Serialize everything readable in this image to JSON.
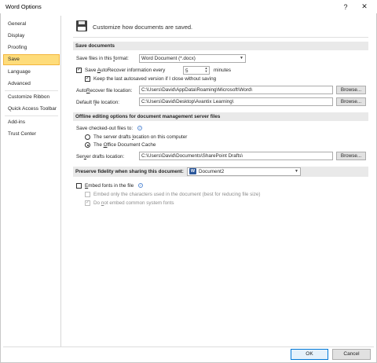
{
  "window": {
    "title": "Word Options",
    "help_glyph": "?",
    "close_glyph": "✕"
  },
  "sidebar": {
    "items": [
      {
        "label": "General"
      },
      {
        "label": "Display"
      },
      {
        "label": "Proofing"
      },
      {
        "label": "Save",
        "selected": true
      },
      {
        "label": "Language"
      },
      {
        "label": "Advanced"
      },
      {
        "label": "Customize Ribbon"
      },
      {
        "label": "Quick Access Toolbar"
      },
      {
        "label": "Add-ins"
      },
      {
        "label": "Trust Center"
      }
    ]
  },
  "header": {
    "icon": "save-icon",
    "text": "Customize how documents are saved."
  },
  "save_documents": {
    "title": "Save documents",
    "format_label_pre": "Save files in this ",
    "format_label_u": "f",
    "format_label_post": "ormat:",
    "format_value": "Word Document (*.docx)",
    "autorecover_pre": "Save ",
    "autorecover_u": "A",
    "autorecover_post": "utoRecover information every",
    "autorecover_checked": "✓",
    "autorecover_minutes": "5",
    "minutes_label": "minutes",
    "keep_last_label": "Keep the last autosaved version if I close without saving",
    "keep_last_checked": "✓",
    "autorecover_location_pre": "Auto",
    "autorecover_location_u": "R",
    "autorecover_location_post": "ecover file location:",
    "autorecover_location_value": "C:\\Users\\David\\AppData\\Roaming\\Microsoft\\Word\\",
    "default_location_pre": "Default f",
    "default_location_u": "i",
    "default_location_post": "le location:",
    "default_location_value": "C:\\Users\\David\\Desktop\\Avantix Learning\\",
    "browse_label": "Browse..."
  },
  "offline_editing": {
    "title": "Offline editing options for document management server files",
    "save_checked_out_label": "Save checked-out files to:",
    "option_server_pre": "The server drafts ",
    "option_server_u": "l",
    "option_server_post": "ocation on this computer",
    "option_cache_pre": "The ",
    "option_cache_u": "O",
    "option_cache_post": "ffice Document Cache",
    "server_drafts_pre": "Ser",
    "server_drafts_u": "v",
    "server_drafts_post": "er drafts location:",
    "server_drafts_value": "C:\\Users\\David\\Documents\\SharePoint Drafts\\",
    "browse_label": "Browse..."
  },
  "preserve_fidelity": {
    "title": "Preserve fidelity when sharing this document:",
    "document_value": "Document2",
    "document_icon": "word-doc-icon",
    "embed_fonts_pre": "",
    "embed_fonts_u": "E",
    "embed_fonts_post": "mbed fonts in the file",
    "embed_only_label": "Embed only the characters used in the document (best for reducing file size)",
    "do_not_embed_pre": "Do ",
    "do_not_embed_u": "n",
    "do_not_embed_post": "ot embed common system fonts",
    "do_not_embed_checked": "✓"
  },
  "footer": {
    "ok_label": "OK",
    "cancel_label": "Cancel"
  }
}
